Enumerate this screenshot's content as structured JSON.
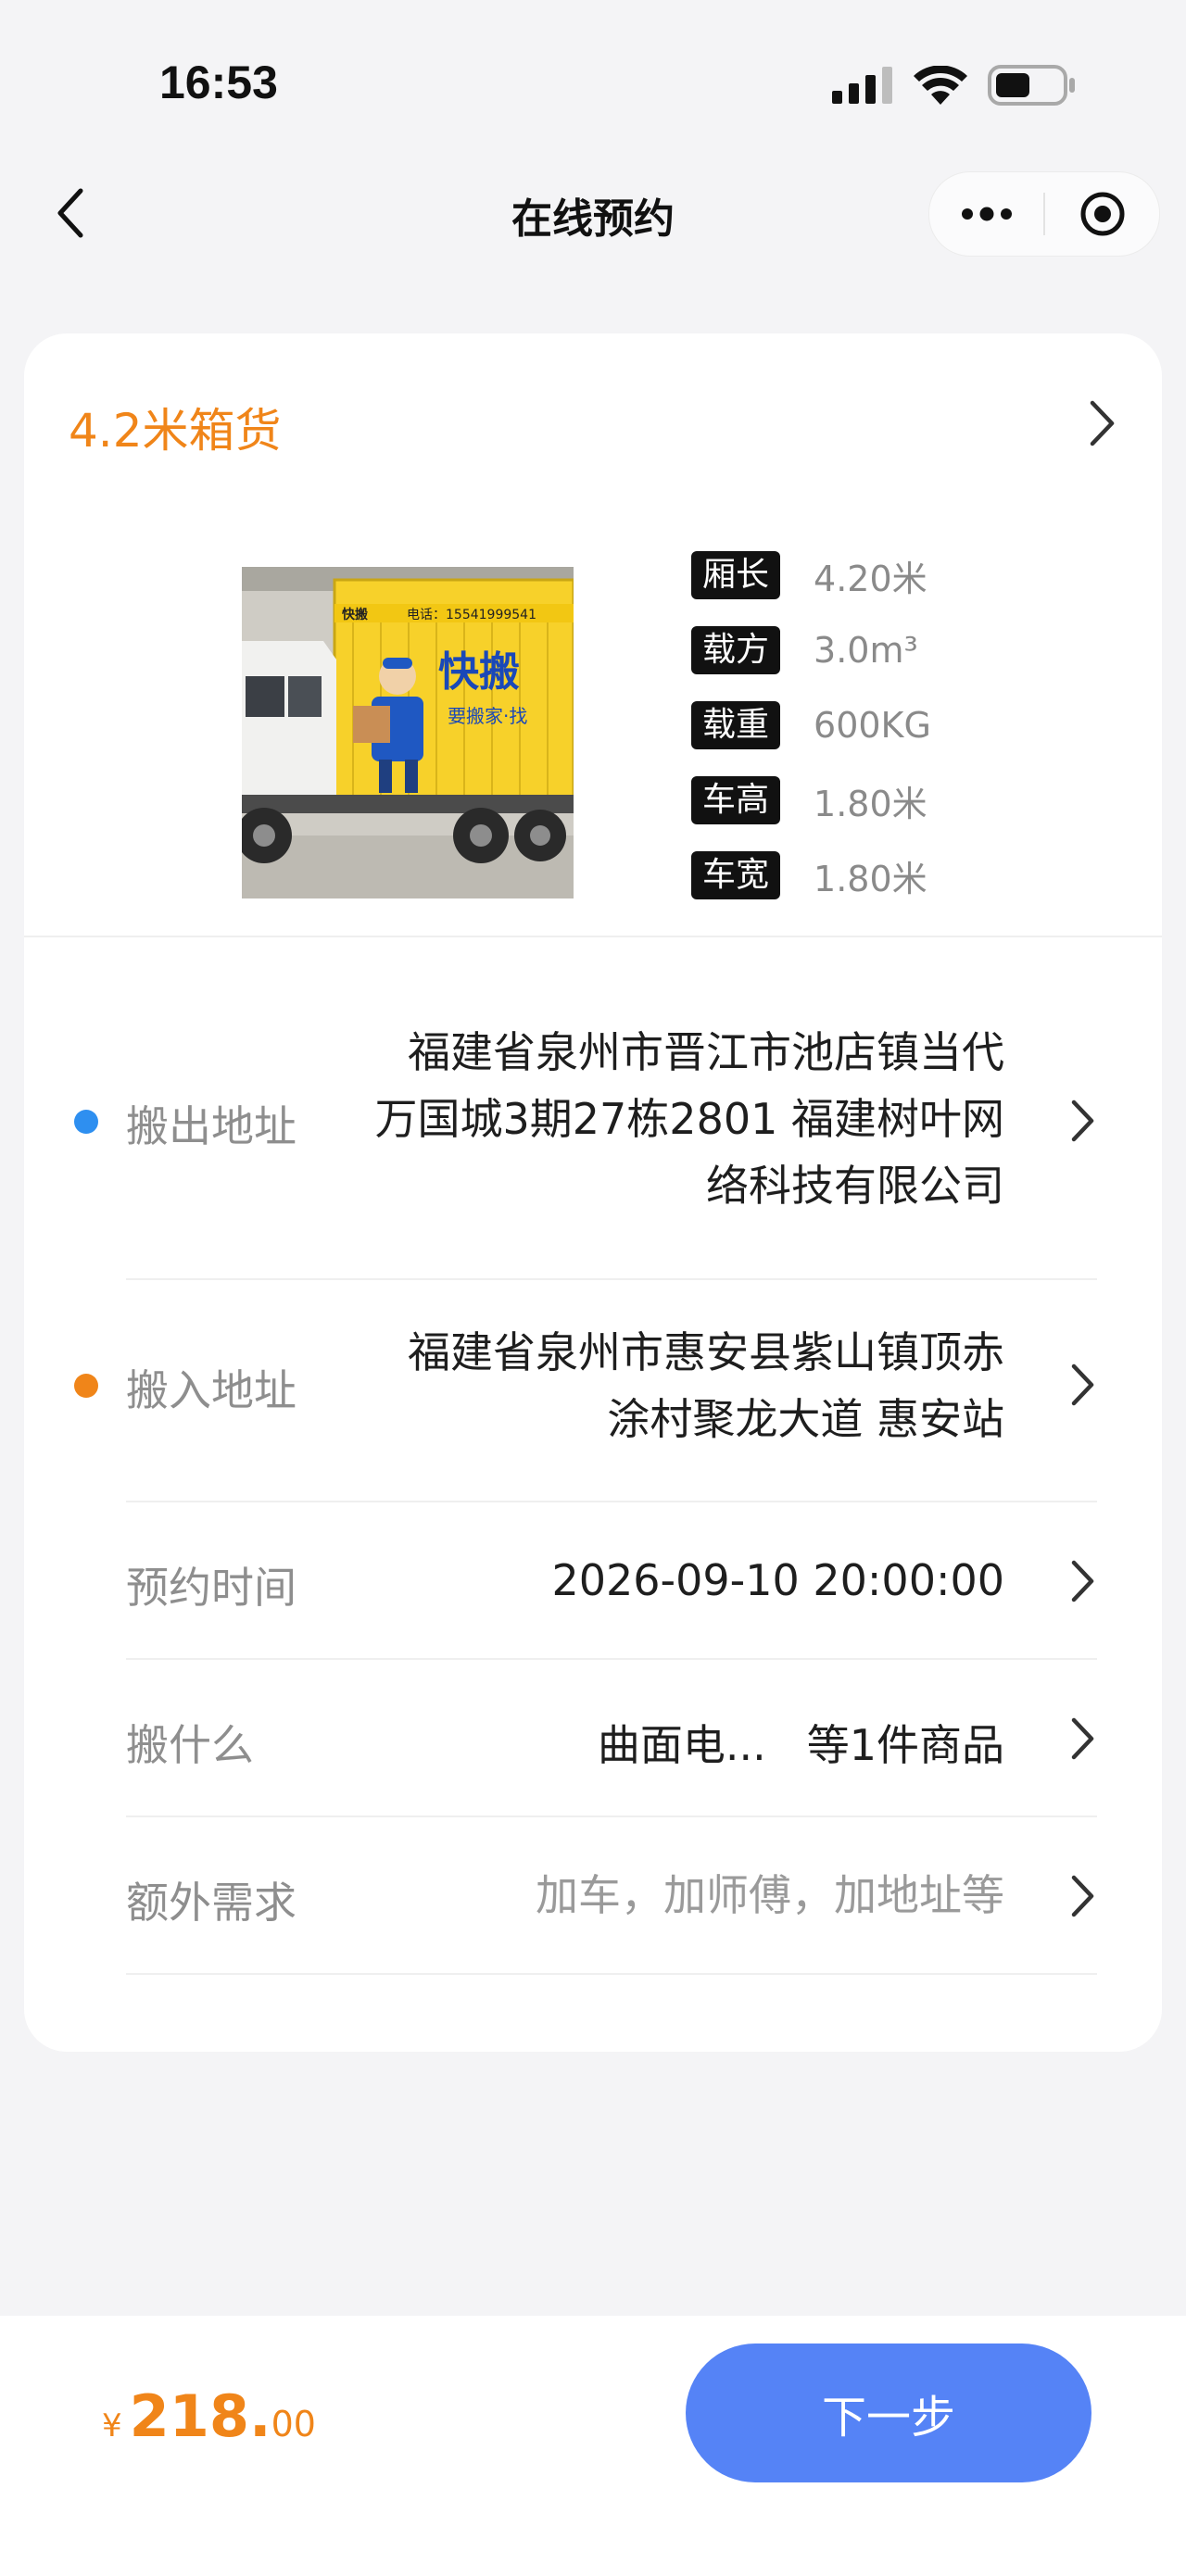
{
  "status_bar": {
    "time": "16:53"
  },
  "nav": {
    "title": "在线预约"
  },
  "vehicle": {
    "name": "4.2米箱货",
    "image_texts": {
      "brand": "快搬",
      "phone": "电话：15541999541",
      "slogan": "要搬家·找"
    },
    "specs": [
      {
        "label": "厢长",
        "value": "4.20米"
      },
      {
        "label": "载方",
        "value": "3.0m³"
      },
      {
        "label": "载重",
        "value": "600KG"
      },
      {
        "label": "车高",
        "value": "1.80米"
      },
      {
        "label": "车宽",
        "value": "1.80米"
      }
    ]
  },
  "rows": {
    "move_out": {
      "label": "搬出地址",
      "lines": [
        "福建省泉州市晋江市池店镇当代",
        "万国城3期27栋2801 福建树叶网",
        "络科技有限公司"
      ],
      "dot_color": "#2e8ff0"
    },
    "move_in": {
      "label": "搬入地址",
      "lines": [
        "福建省泉州市惠安县紫山镇顶赤",
        "涂村聚龙大道 惠安站"
      ],
      "dot_color": "#f08519"
    },
    "time": {
      "label": "预约时间",
      "value": "2026-09-10 20:00:00"
    },
    "goods": {
      "label": "搬什么",
      "item": "曲面电...",
      "count": "等1件商品"
    },
    "extra": {
      "label": "额外需求",
      "placeholder": "加车，加师傅，加地址等"
    }
  },
  "footer": {
    "currency": "¥",
    "price_integer": "218.",
    "price_decimal": "00",
    "next_label": "下一步"
  },
  "colors": {
    "accent_orange": "#f08519",
    "primary_blue": "#5583f6",
    "dot_blue": "#2e8ff0"
  }
}
